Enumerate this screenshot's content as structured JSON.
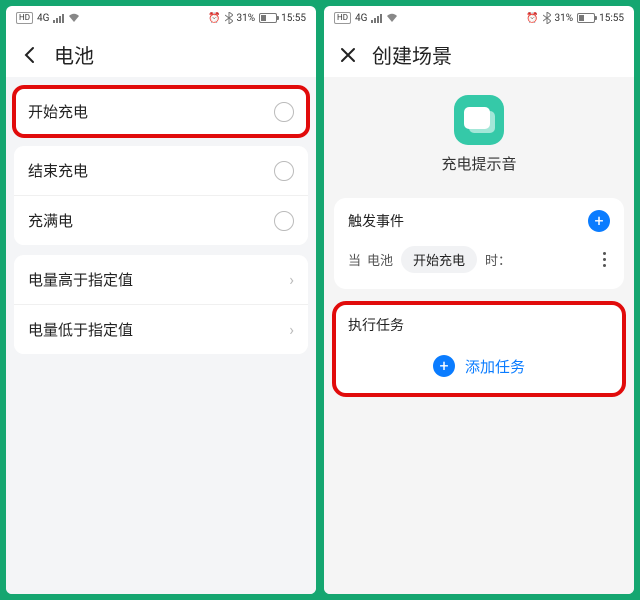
{
  "status": {
    "hd": "HD",
    "net": "4G",
    "bt": "",
    "pct": "31%",
    "time": "15:55"
  },
  "left": {
    "title": "电池",
    "items": [
      {
        "label": "开始充电",
        "kind": "radio",
        "hl": true
      },
      {
        "label": "结束充电",
        "kind": "radio"
      },
      {
        "label": "充满电",
        "kind": "radio"
      },
      {
        "label": "电量高于指定值",
        "kind": "nav"
      },
      {
        "label": "电量低于指定值",
        "kind": "nav"
      }
    ]
  },
  "right": {
    "title": "创建场景",
    "scene_name": "充电提示音",
    "trigger": {
      "title": "触发事件",
      "when": "当",
      "cat": "电池",
      "val": "开始充电",
      "suffix": "时："
    },
    "tasks": {
      "title": "执行任务",
      "add": "添加任务"
    }
  }
}
